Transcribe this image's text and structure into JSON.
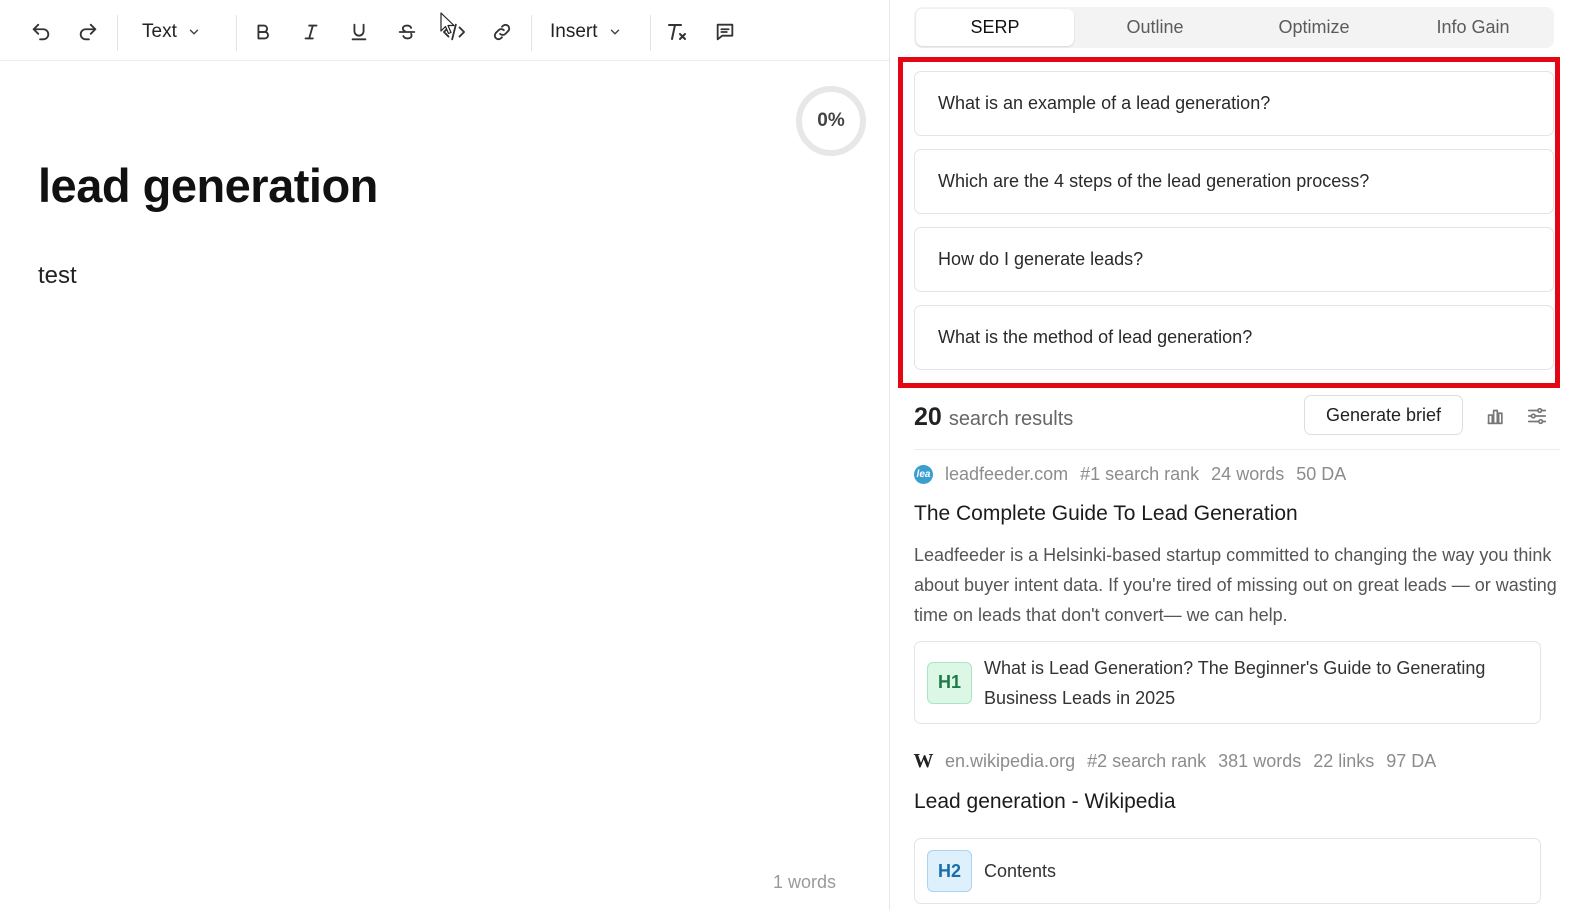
{
  "toolbar": {
    "text_dropdown": "Text",
    "insert_dropdown": "Insert",
    "icons": [
      "undo-icon",
      "redo-icon",
      "bold-icon",
      "italic-icon",
      "underline-icon",
      "strikethrough-icon",
      "code-icon",
      "link-icon",
      "clear-format-icon",
      "comment-icon"
    ]
  },
  "editor": {
    "progress_label": "0%",
    "progress_value": 0,
    "title": "lead generation",
    "body": "test",
    "word_count": "1 words"
  },
  "panel": {
    "tabs": [
      {
        "label": "SERP",
        "active": true
      },
      {
        "label": "Outline",
        "active": false
      },
      {
        "label": "Optimize",
        "active": false
      },
      {
        "label": "Info Gain",
        "active": false
      }
    ],
    "highlight_color": "#e30613",
    "questions": [
      "What is an example of a lead generation?",
      "Which are the 4 steps of the lead generation process?",
      "How do I generate leads?",
      "What is the method of lead generation?"
    ],
    "results_count": "20",
    "results_label": "search results",
    "generate_brief_label": "Generate brief",
    "results": [
      {
        "domain": "leadfeeder.com",
        "rank": "#1 search rank",
        "words": "24 words",
        "da": "50 DA",
        "title": "The Complete Guide To Lead Generation",
        "description": "Leadfeeder is a Helsinki-based startup committed to changing the way you think about buyer intent data. If you're tired of missing out on great leads — or wasting time on leads that don't convert— we can help.",
        "heading_level": "H1",
        "heading_text": "What is Lead Generation? The Beginner's Guide to Generating Business Leads in 2025"
      },
      {
        "domain": "en.wikipedia.org",
        "rank": "#2 search rank",
        "words": "381 words",
        "links": "22 links",
        "da": "97 DA",
        "favicon_letter": "W",
        "title": "Lead generation - Wikipedia",
        "heading_level": "H2",
        "heading_text": "Contents"
      }
    ]
  }
}
